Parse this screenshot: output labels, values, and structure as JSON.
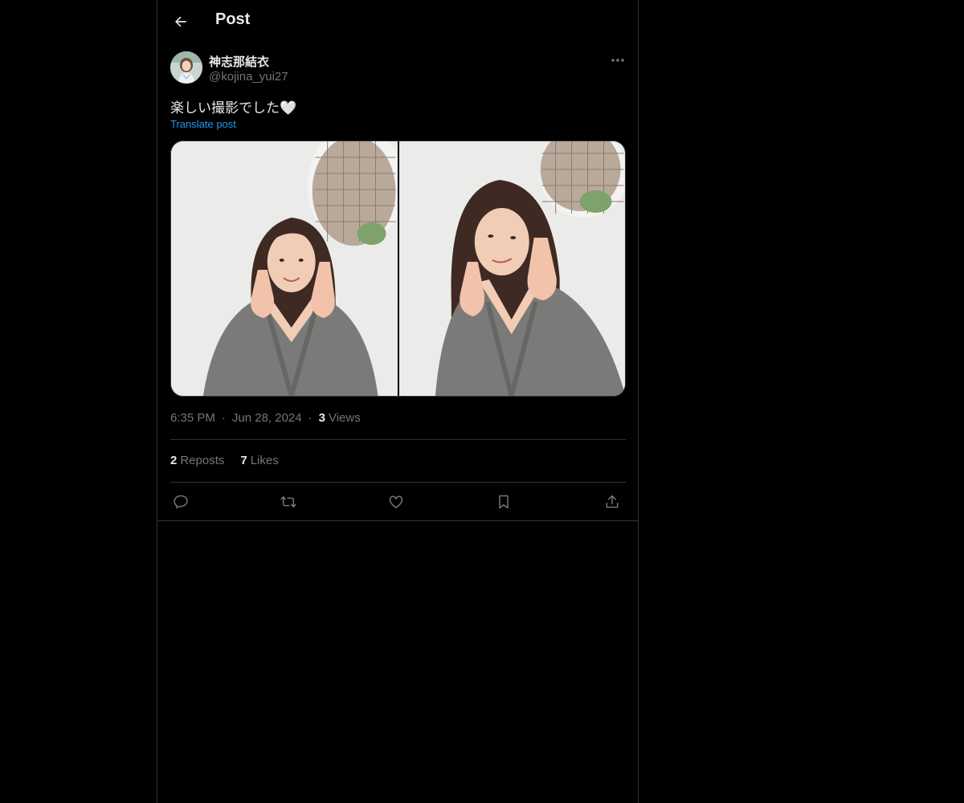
{
  "header": {
    "back_icon": "arrow-left-icon",
    "title": "Post"
  },
  "author": {
    "display_name": "神志那結衣",
    "handle": "@kojina_yui27",
    "avatar_icon": "avatar-photo"
  },
  "post": {
    "text": "楽しい撮影でした🤍",
    "translate_label": "Translate post",
    "media_count": 2
  },
  "meta": {
    "time": "6:35 PM",
    "date": "Jun 28, 2024",
    "views_count": "3",
    "views_label": "Views",
    "separator": "·"
  },
  "stats": {
    "reposts_count": "2",
    "reposts_label": "Reposts",
    "likes_count": "7",
    "likes_label": "Likes"
  },
  "actions": [
    "reply-icon",
    "repost-icon",
    "like-icon",
    "bookmark-icon",
    "share-icon"
  ],
  "colors": {
    "background": "#000000",
    "text": "#e7e9ea",
    "muted": "#71767b",
    "link": "#1d9bf0",
    "border": "#2f3336"
  }
}
